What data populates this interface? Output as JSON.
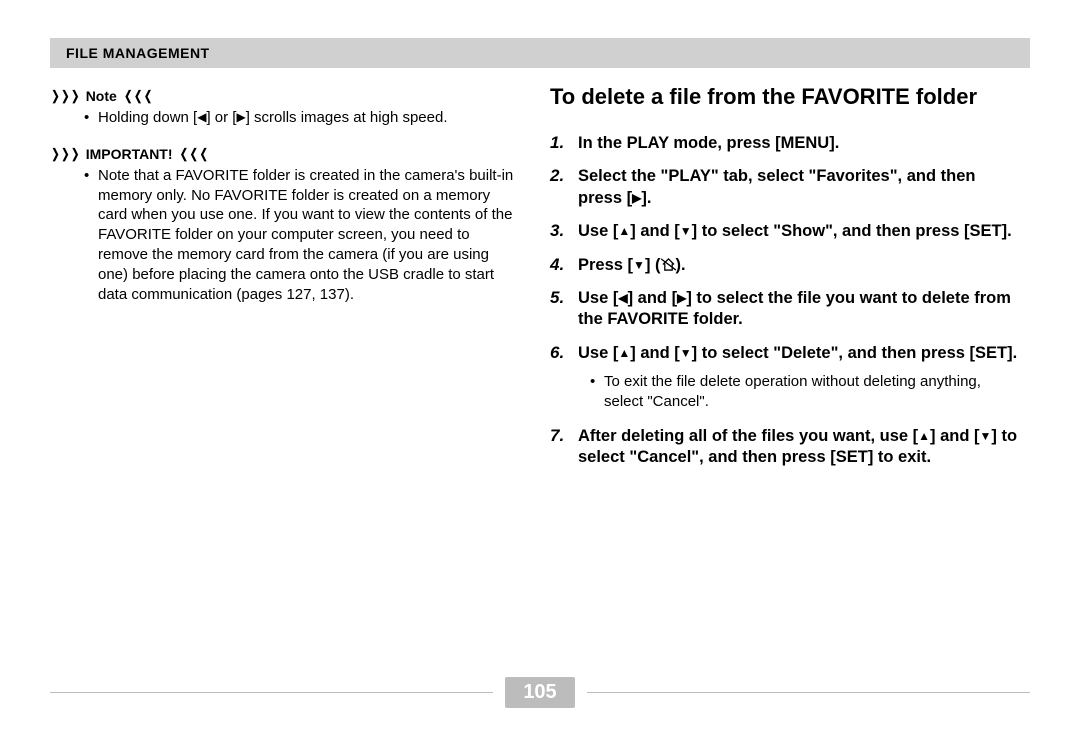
{
  "header": {
    "title": "File Management"
  },
  "left": {
    "note_label": "Note",
    "note_body_a": "Holding down [",
    "note_body_b": "] or [",
    "note_body_c": "] scrolls images at high speed.",
    "important_label": "IMPORTANT!",
    "important_body": "Note that a FAVORITE folder is created in the camera's built-in memory only. No FAVORITE folder is created on a memory card when you use one. If you want to view the contents of the FAVORITE folder on your computer screen, you need to remove the memory card from the camera (if you are using one) before placing the camera onto the USB cradle to start data communication (pages 127, 137)."
  },
  "right": {
    "title": "To delete a file from the FAVORITE folder",
    "steps": {
      "s1": "In the PLAY mode, press [MENU].",
      "s2a": "Select the \"PLAY\" tab, select \"Favorites\", and then press [",
      "s2b": "].",
      "s3a": "Use [",
      "s3b": "] and [",
      "s3c": "] to select \"Show\", and then press [SET].",
      "s4a": "Press [",
      "s4b": "] (",
      "s4c": ").",
      "s5a": "Use [",
      "s5b": "] and [",
      "s5c": "] to select the file you want to delete from the FAVORITE folder.",
      "s6a": "Use [",
      "s6b": "] and [",
      "s6c": "] to select \"Delete\", and then press [SET].",
      "s6_sub": "To exit the file delete operation without deleting anything, select \"Cancel\".",
      "s7a": "After deleting all of the files you want, use [",
      "s7b": "] and [",
      "s7c": "] to select \"Cancel\", and then press [SET] to exit."
    }
  },
  "footer": {
    "page_number": "105"
  },
  "glyphs": {
    "tri_left": "◀",
    "tri_right": "▶",
    "tri_up": "▲",
    "tri_down": "▼",
    "marker_right": "❭❭❭",
    "marker_left": "❬❬❬",
    "bullet": "•"
  }
}
